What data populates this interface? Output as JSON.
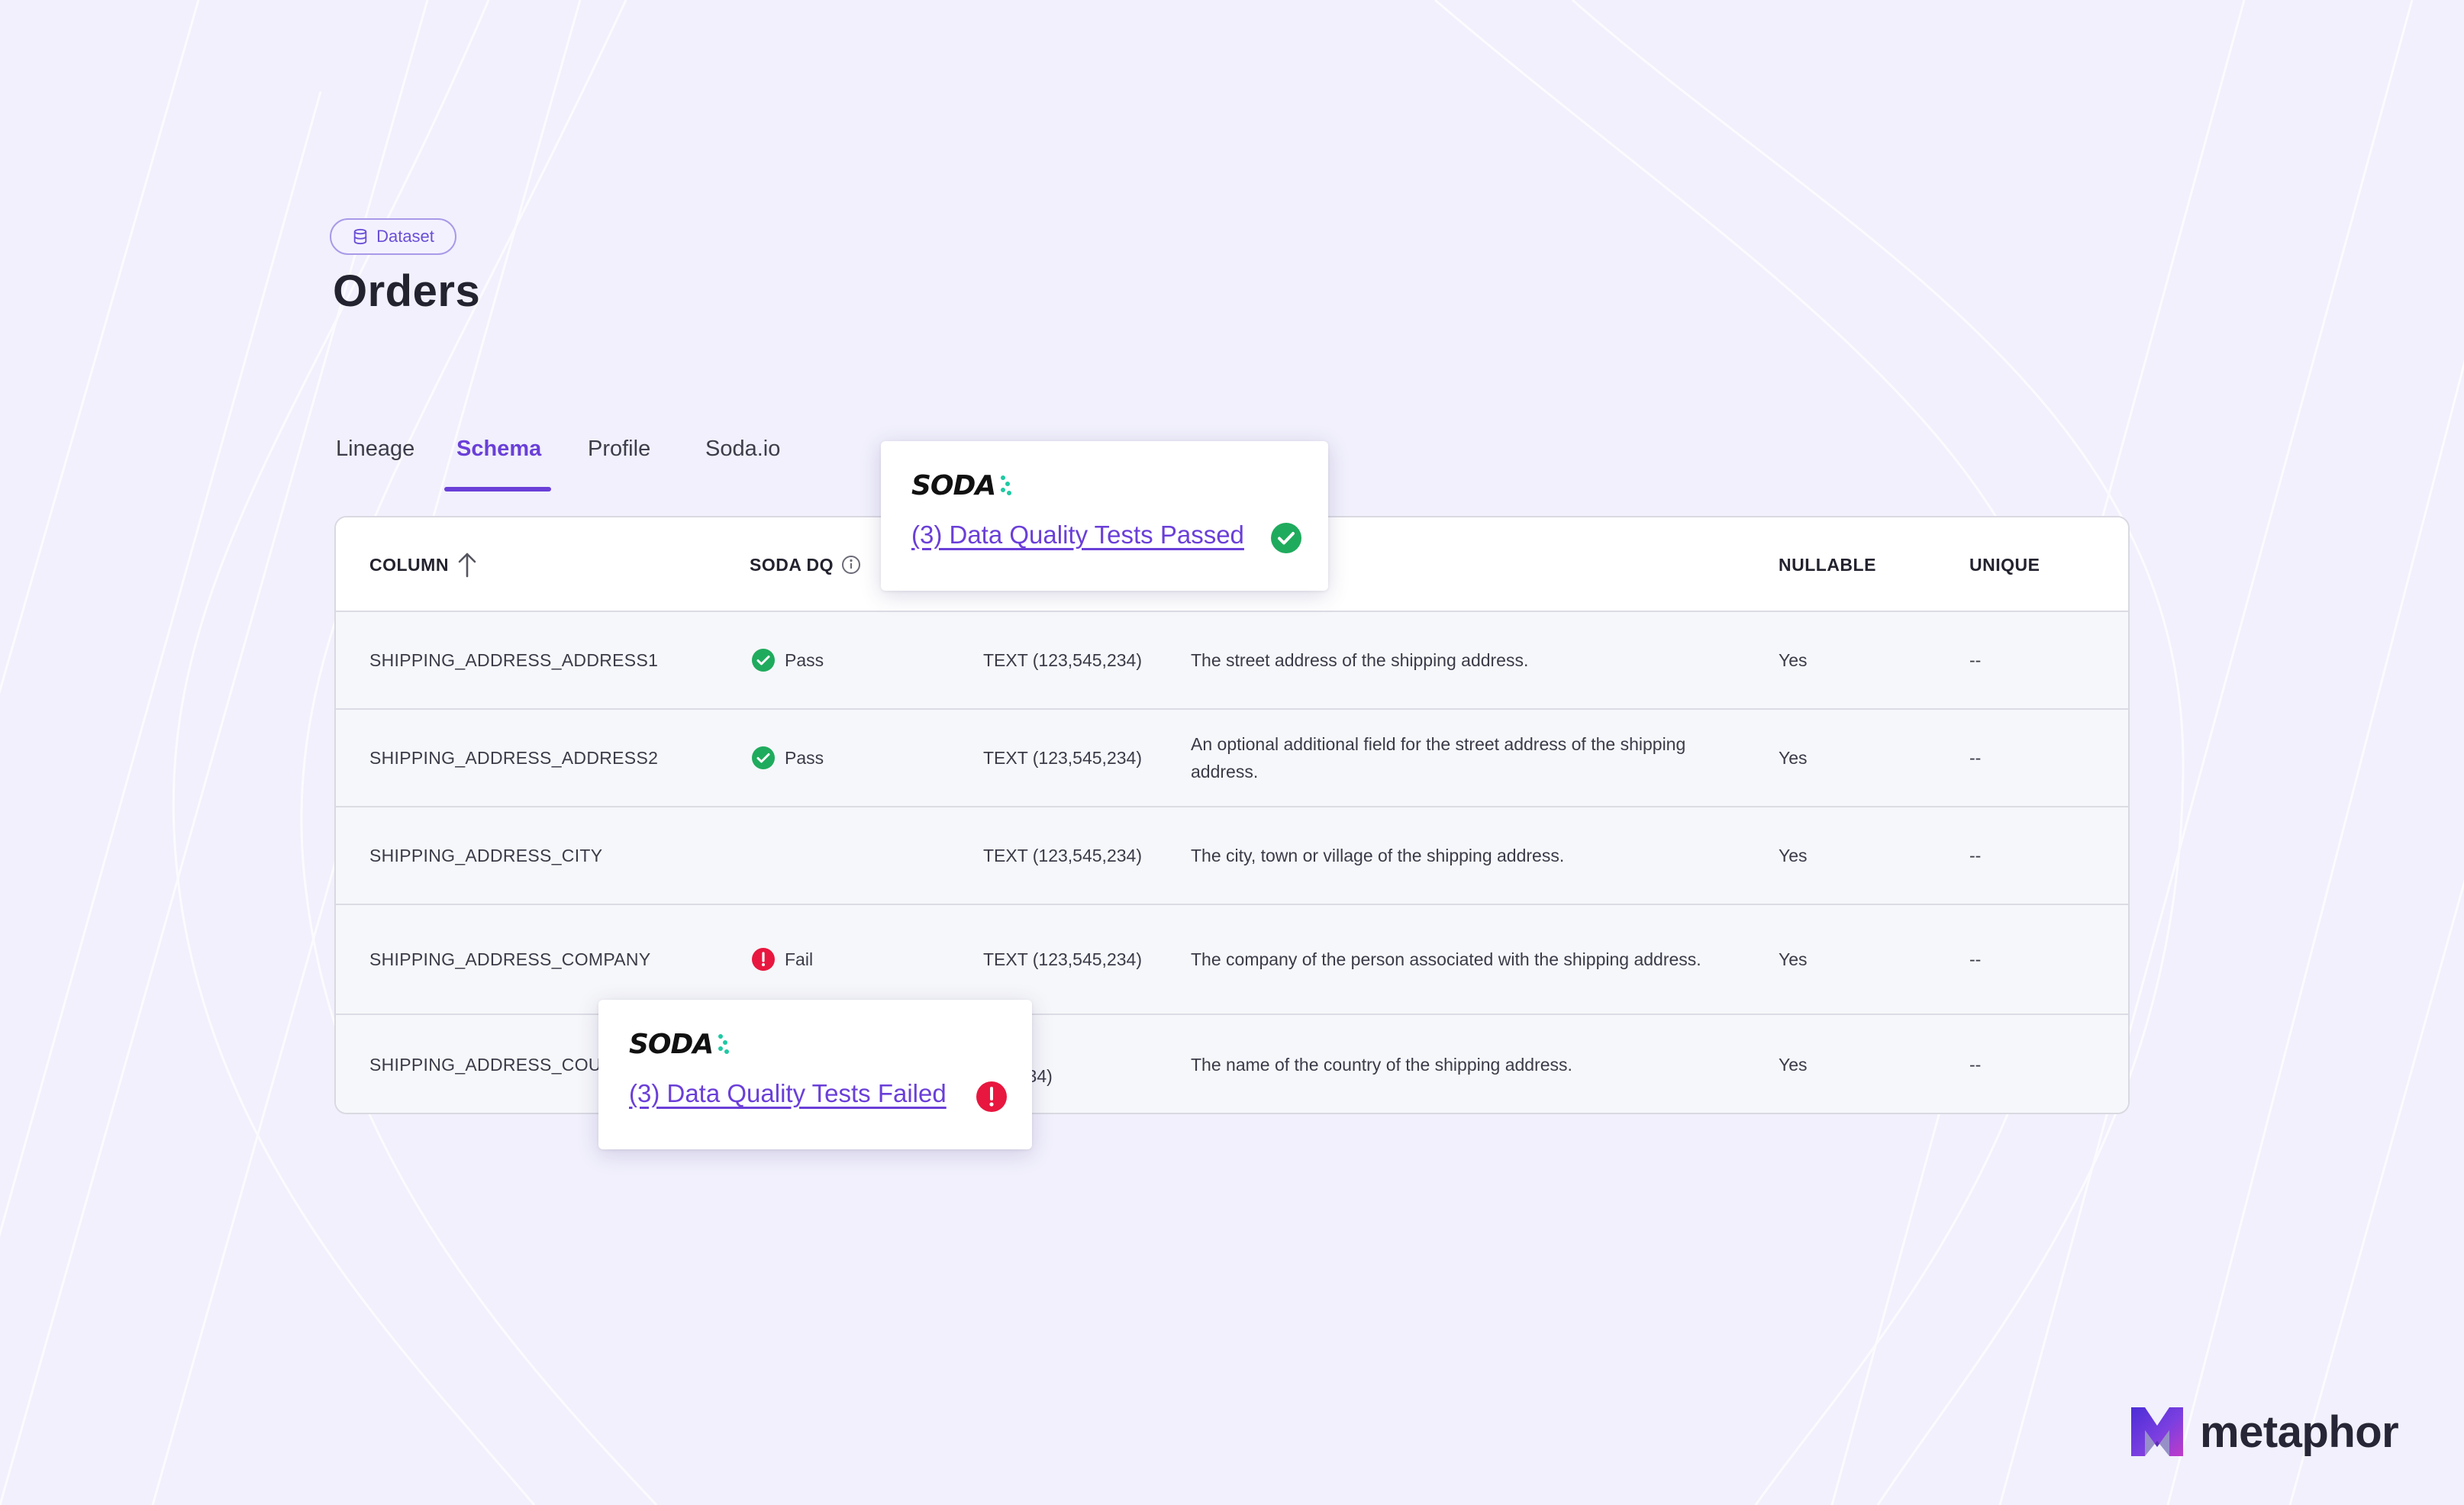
{
  "badge": {
    "label": "Dataset",
    "icon": "database-icon"
  },
  "page_title": "Orders",
  "tabs": [
    {
      "label": "Lineage",
      "active": false
    },
    {
      "label": "Schema",
      "active": true
    },
    {
      "label": "Profile",
      "active": false
    },
    {
      "label": "Soda.io",
      "active": false
    }
  ],
  "table": {
    "headers": {
      "column": "COLUMN",
      "soda_dq": "SODA DQ",
      "nullable": "NULLABLE",
      "unique": "UNIQUE"
    },
    "rows": [
      {
        "name": "SHIPPING_ADDRESS_ADDRESS1",
        "dq": "Pass",
        "dq_status": "pass",
        "type": "TEXT (123,545,234)",
        "description": "The street address of the shipping address.",
        "nullable": "Yes",
        "unique": "--"
      },
      {
        "name": "SHIPPING_ADDRESS_ADDRESS2",
        "dq": "Pass",
        "dq_status": "pass",
        "type": "TEXT (123,545,234)",
        "description": "An optional additional field for the street address of the shipping address.",
        "nullable": "Yes",
        "unique": "--"
      },
      {
        "name": "SHIPPING_ADDRESS_CITY",
        "dq": "",
        "dq_status": "none",
        "type": "TEXT (123,545,234)",
        "description": "The city, town or village of the shipping address.",
        "nullable": "Yes",
        "unique": "--"
      },
      {
        "name": "SHIPPING_ADDRESS_COMPANY",
        "dq": "Fail",
        "dq_status": "fail",
        "type": "TEXT (123,545,234)",
        "description": "The company of the person associated with the shipping address.",
        "nullable": "Yes",
        "unique": "--"
      },
      {
        "name": "SHIPPING_ADDRESS_COUI",
        "dq": "",
        "dq_status": "none",
        "type": "545,234)",
        "description": "The name of the country of the shipping address.",
        "nullable": "Yes",
        "unique": "--"
      }
    ]
  },
  "popup_passed": {
    "logo": "SODA",
    "link": "(3) Data Quality Tests Passed",
    "icon": "check-circle-icon"
  },
  "popup_failed": {
    "logo": "SODA",
    "link": "(3) Data Quality Tests Failed",
    "icon": "alert-circle-icon"
  },
  "brand": {
    "name": "metaphor"
  },
  "colors": {
    "accent": "#6a3fd8",
    "pass": "#1fab5d",
    "fail": "#e8173f",
    "soda_dot": "#1ec9a3",
    "background": "#f1f0fc"
  }
}
